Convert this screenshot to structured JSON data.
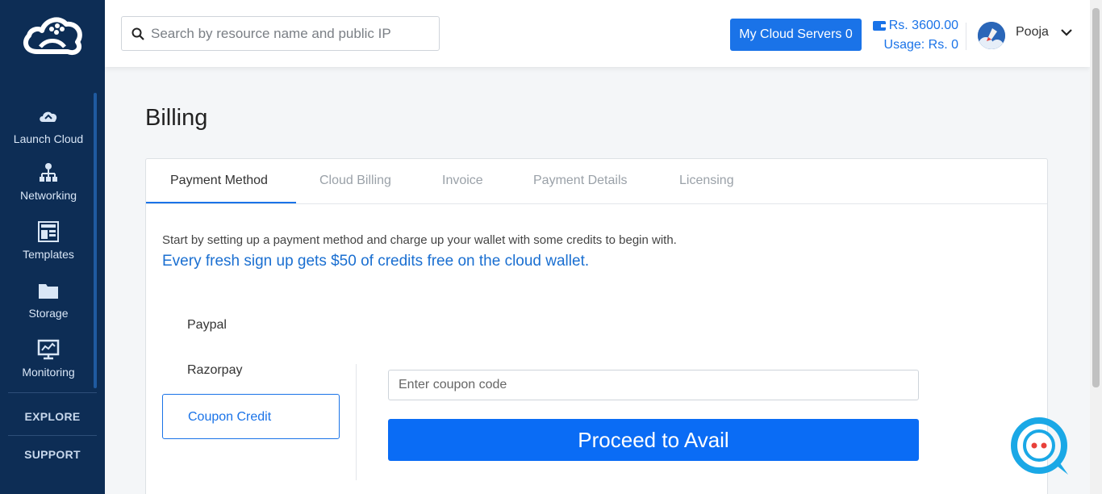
{
  "sidebar": {
    "items": [
      {
        "label": "Launch Cloud",
        "icon": "cloud-launch-icon"
      },
      {
        "label": "Networking",
        "icon": "network-icon"
      },
      {
        "label": "Templates",
        "icon": "templates-icon"
      },
      {
        "label": "Storage",
        "icon": "folder-icon"
      },
      {
        "label": "Monitoring",
        "icon": "monitor-icon"
      }
    ],
    "explore": "EXPLORE",
    "support": "SUPPORT"
  },
  "header": {
    "search_placeholder": "Search by resource name and public IP",
    "servers_button": "My Cloud Servers 0",
    "wallet_balance": "Rs. 3600.00",
    "usage": "Usage: Rs. 0",
    "user_name": "Pooja"
  },
  "page": {
    "title": "Billing",
    "tabs": [
      "Payment Method",
      "Cloud Billing",
      "Invoice",
      "Payment Details",
      "Licensing"
    ],
    "intro": "Start by setting up a payment method and charge up your wallet with some credits to begin with.",
    "promo": "Every fresh sign up gets $50 of credits free on the cloud wallet.",
    "payment_methods": [
      "Paypal",
      "Razorpay",
      "Coupon Credit"
    ],
    "coupon_placeholder": "Enter coupon code",
    "proceed_button": "Proceed to Avail"
  },
  "colors": {
    "sidebar_bg": "#0d2d55",
    "accent": "#1a73e8",
    "chat_bubble": "#1aa8e6",
    "chat_dots": "#e8413a"
  }
}
